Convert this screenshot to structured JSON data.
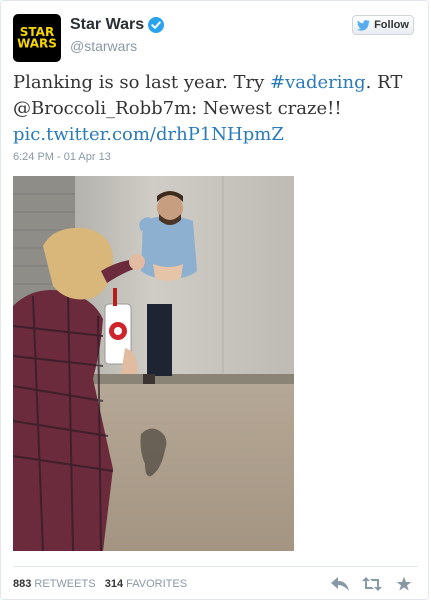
{
  "author": {
    "name": "Star Wars",
    "handle": "@starwars",
    "logo_line1": "STAR",
    "logo_line2": "WARS"
  },
  "follow_label": "Follow",
  "tweet": {
    "part1": "Planking is so last year. Try ",
    "hashtag": "#vadering",
    "part2": ". RT @Broccoli_Robb7m: Newest craze!! ",
    "link": "pic.twitter.com/drhP1NHpmZ"
  },
  "timestamp": "6:24 PM - 01 Apr 13",
  "stats": {
    "retweets_count": "883",
    "retweets_label": "RETWEETS",
    "favorites_count": "314",
    "favorites_label": "FAVORITES"
  },
  "icons": {
    "verified": "verified-badge-icon",
    "follow_bird": "twitter-bird-icon",
    "reply": "reply-icon",
    "retweet": "retweet-icon",
    "favorite": "star-icon"
  },
  "colors": {
    "link": "#2b7bb9",
    "verified": "#2aa3ef",
    "muted": "#8899a6",
    "logo": "#f5d500"
  }
}
